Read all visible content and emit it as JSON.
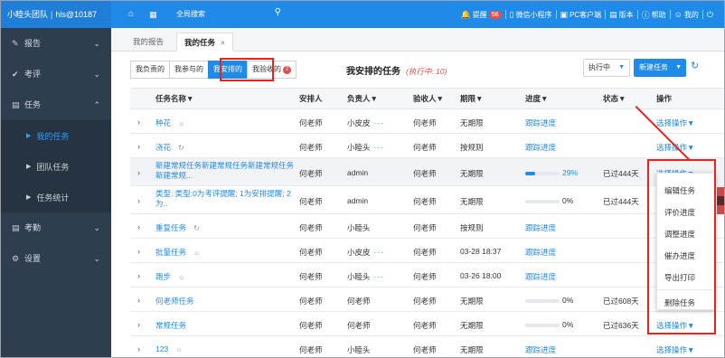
{
  "topbar": {
    "brand": "小睦头团队",
    "account": "hls@10187",
    "home_icon": "home-icon",
    "apps_icon": "apps-icon",
    "search_label": "全局搜索",
    "remind_label": "提醒",
    "remind_count": "56",
    "wechat_label": "微信小程序",
    "pc_label": "PC客户端",
    "version_label": "版本",
    "help_label": "帮助",
    "mine_label": "我的"
  },
  "sidebar": {
    "items": [
      {
        "label": "报告",
        "icon": "edit-icon"
      },
      {
        "label": "考评",
        "icon": "check-icon"
      },
      {
        "label": "任务",
        "icon": "list-icon"
      },
      {
        "label": "考勤",
        "icon": "list-icon"
      },
      {
        "label": "设置",
        "icon": "gear-icon"
      }
    ],
    "task_sub": [
      "我的任务",
      "团队任务",
      "任务统计"
    ]
  },
  "tabs": {
    "items": [
      "我的报告",
      "我的任务"
    ],
    "close": "×"
  },
  "filters": {
    "buttons": [
      "我负责的",
      "我参与的",
      "我安排的",
      "我验收的"
    ],
    "active_index": 2,
    "verify_count": "2"
  },
  "heading": {
    "title": "我安排的任务",
    "subtitle": "(执行中: 10)"
  },
  "toolbar": {
    "status_select": "执行中",
    "new_task": "新建任务",
    "refresh_icon": "refresh-icon"
  },
  "table": {
    "headers": [
      "任务名称▼",
      "安排人",
      "负责人▼",
      "验收人▼",
      "期限▼",
      "进度▼",
      "状态▼",
      "操作"
    ],
    "rows": [
      {
        "name": "种花",
        "arranger": "何老师",
        "owner": "小皮皮",
        "owner_more": "···",
        "verifier": "何老师",
        "deadline": "无期限",
        "progress_text": "跟踪进度",
        "progress_pct": "",
        "status": "",
        "op": "选择操作▼",
        "icon": "group-icon"
      },
      {
        "name": "浇花",
        "arranger": "何老师",
        "owner": "小睦头",
        "owner_more": "···",
        "verifier": "何老师",
        "deadline": "按规则",
        "progress_text": "跟踪进度",
        "progress_pct": "",
        "status": "",
        "op": "选择操作▼",
        "icon": "repeat-icon"
      },
      {
        "name": "新建常规任务新建常规任务新建常规任务新建常规...",
        "arranger": "何老师",
        "owner": "admin",
        "owner_more": "",
        "verifier": "何老师",
        "deadline": "无期限",
        "progress_text": "",
        "progress_pct": "29%",
        "progress_value": 29,
        "status": "已过444天",
        "op": "选择操作▼",
        "icon": ""
      },
      {
        "name": "类型: 类型:0为考评提醒; 1为安排提醒; 2为..",
        "arranger": "何老师",
        "owner": "admin",
        "owner_more": "",
        "verifier": "何老师",
        "deadline": "无期限",
        "progress_text": "",
        "progress_pct": "0%",
        "progress_value": 0,
        "status": "已过444天",
        "op": "",
        "icon": ""
      },
      {
        "name": "重复任务",
        "arranger": "何老师",
        "owner": "小睦头",
        "owner_more": "",
        "verifier": "何老师",
        "deadline": "按规则",
        "progress_text": "跟踪进度",
        "progress_pct": "",
        "status": "",
        "op": "",
        "icon": "repeat-icon"
      },
      {
        "name": "批量任务",
        "arranger": "何老师",
        "owner": "小皮皮",
        "owner_more": "···",
        "verifier": "何老师",
        "deadline": "03-28 18:37",
        "progress_text": "跟踪进度",
        "progress_pct": "",
        "status": "",
        "op": "",
        "icon": "group-icon"
      },
      {
        "name": "跑步",
        "arranger": "何老师",
        "owner": "小睦头",
        "owner_more": "···",
        "verifier": "何老师",
        "deadline": "03-26 18:00",
        "progress_text": "跟踪进度",
        "progress_pct": "",
        "status": "",
        "op": "",
        "icon": "group-icon"
      },
      {
        "name": "何老师任务",
        "arranger": "何老师",
        "owner": "何老师",
        "owner_more": "",
        "verifier": "何老师",
        "deadline": "无期限",
        "progress_text": "",
        "progress_pct": "0%",
        "progress_value": 0,
        "status": "已过608天",
        "op": "",
        "icon": ""
      },
      {
        "name": "常规任务",
        "arranger": "何老师",
        "owner": "何老师",
        "owner_more": "",
        "verifier": "何老师",
        "deadline": "无期限",
        "progress_text": "",
        "progress_pct": "0%",
        "progress_value": 0,
        "status": "已过636天",
        "op": "选择操作▼",
        "icon": ""
      },
      {
        "name": "123",
        "arranger": "何老师",
        "owner": "小睦头",
        "owner_more": "",
        "verifier": "何老师",
        "deadline": "无期限",
        "progress_text": "跟踪进度",
        "progress_pct": "",
        "status": "",
        "op": "选择操作▼",
        "icon": "group-icon"
      }
    ]
  },
  "dropdown": {
    "items": [
      "编辑任务",
      "评价进度",
      "调整进度",
      "催办进度",
      "导出打印",
      "删除任务"
    ]
  },
  "colors": {
    "primary": "#1f8ae8",
    "sidebar": "#2f3e4e",
    "annotation": "#e8231a"
  }
}
